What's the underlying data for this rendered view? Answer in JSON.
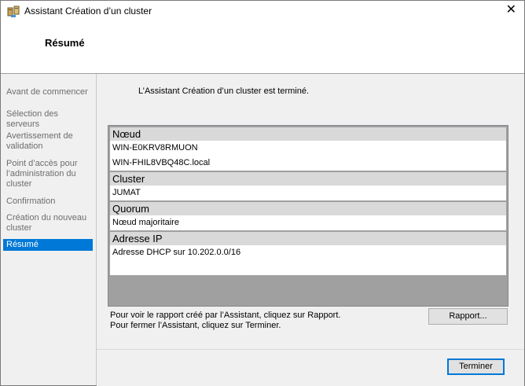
{
  "window": {
    "title": "Assistant Création d’un cluster",
    "close_glyph": "✕",
    "icon": "cluster-wizard-icon"
  },
  "header": {
    "title": "Résumé"
  },
  "sidebar": {
    "items": [
      {
        "label": "Avant de commencer"
      },
      {
        "label": "Sélection des serveurs"
      },
      {
        "label": "Avertissement de validation"
      },
      {
        "label": "Point d’accès pour l’administration du cluster"
      },
      {
        "label": "Confirmation"
      },
      {
        "label": "Création du nouveau cluster"
      },
      {
        "label": "Résumé",
        "active": true
      }
    ]
  },
  "main": {
    "done_message": "L’Assistant Création d’un cluster est terminé.",
    "summary": {
      "node_header": "Nœud",
      "nodes": [
        "WIN-E0KRV8RMUON",
        "WIN-FHIL8VBQ48C.local"
      ],
      "cluster_header": "Cluster",
      "cluster_name": "JUMAT",
      "quorum_header": "Quorum",
      "quorum_value": "Nœud majoritaire",
      "ip_header": "Adresse IP",
      "ip_value": "Adresse DHCP sur 10.202.0.0/16"
    },
    "info_report": "Pour voir le rapport créé par l’Assistant, cliquez sur Rapport.",
    "info_finish": "Pour fermer l’Assistant, cliquez sur Terminer.",
    "report_button": "Rapport...",
    "finish_button": "Terminer"
  },
  "colors": {
    "accent": "#0078d7",
    "section_header": "#d9d9d9",
    "listbox_bg": "#a0a0a0",
    "panel_bg": "#f0f0f0"
  }
}
